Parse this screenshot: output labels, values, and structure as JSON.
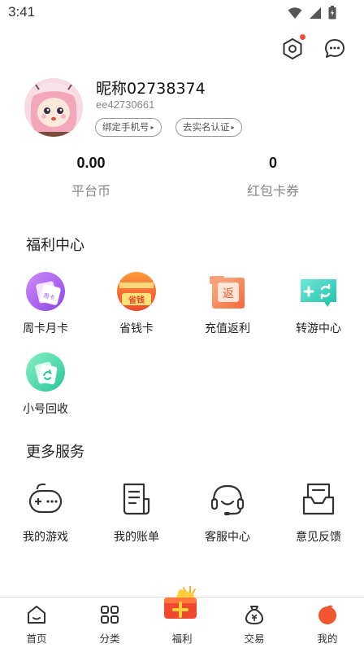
{
  "status_bar": {
    "time": "3:41"
  },
  "profile": {
    "nickname": "昵称02738374",
    "user_id": "ee42730661",
    "bind_phone_label": "绑定手机号",
    "real_name_label": "去实名认证"
  },
  "stats": [
    {
      "value": "0.00",
      "label": "平台币"
    },
    {
      "value": "0",
      "label": "红包卡券"
    }
  ],
  "welfare": {
    "title": "福利中心",
    "items": [
      {
        "label": "周卡月卡",
        "icon": "weekly-monthly-card-icon",
        "badge": "周卡"
      },
      {
        "label": "省钱卡",
        "icon": "saving-card-icon",
        "badge": "省钱"
      },
      {
        "label": "充值返利",
        "icon": "recharge-rebate-icon",
        "badge": "返"
      },
      {
        "label": "转游中心",
        "icon": "transfer-game-icon"
      },
      {
        "label": "小号回收",
        "icon": "account-recycle-icon"
      }
    ]
  },
  "services": {
    "title": "更多服务",
    "items": [
      {
        "label": "我的游戏",
        "icon": "gamepad-icon"
      },
      {
        "label": "我的账单",
        "icon": "bill-icon"
      },
      {
        "label": "客服中心",
        "icon": "headset-icon"
      },
      {
        "label": "意见反馈",
        "icon": "feedback-inbox-icon"
      }
    ]
  },
  "tabbar": {
    "items": [
      {
        "label": "首页",
        "icon": "home-icon"
      },
      {
        "label": "分类",
        "icon": "category-icon"
      },
      {
        "label": "福利",
        "icon": "welfare-gift-icon"
      },
      {
        "label": "交易",
        "icon": "money-bag-icon"
      },
      {
        "label": "我的",
        "icon": "profile-orange-icon"
      }
    ]
  },
  "colors": {
    "accent_red": "#f04a3a",
    "text_primary": "#222222",
    "text_secondary": "#888888",
    "welfare_purple": "#b06cf0",
    "welfare_orange": "#f26a3a",
    "welfare_teal": "#3fd7c3"
  }
}
